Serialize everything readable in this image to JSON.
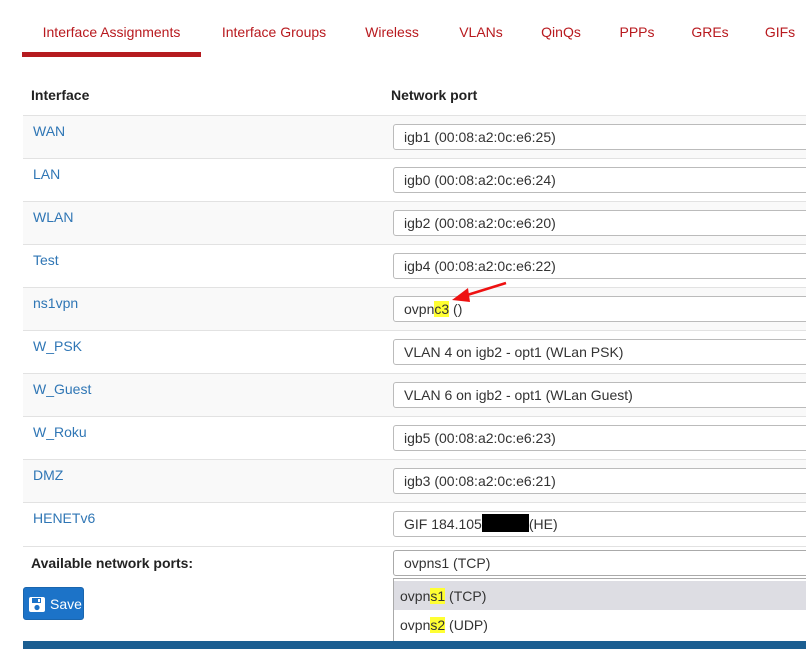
{
  "tabs": [
    {
      "label": "Interface Assignments",
      "active": true
    },
    {
      "label": "Interface Groups"
    },
    {
      "label": "Wireless"
    },
    {
      "label": "VLANs"
    },
    {
      "label": "QinQs"
    },
    {
      "label": "PPPs"
    },
    {
      "label": "GREs"
    },
    {
      "label": "GIFs"
    }
  ],
  "table": {
    "headers": [
      "Interface",
      "Network port"
    ],
    "rows": [
      {
        "interface": "WAN",
        "port": "igb1 (00:08:a2:0c:e6:25)"
      },
      {
        "interface": "LAN",
        "port": "igb0 (00:08:a2:0c:e6:24)"
      },
      {
        "interface": "WLAN",
        "port": "igb2 (00:08:a2:0c:e6:20)"
      },
      {
        "interface": "Test",
        "port": "igb4 (00:08:a2:0c:e6:22)"
      },
      {
        "interface": "ns1vpn",
        "port_parts": [
          "ovpn",
          "c3",
          " ()"
        ]
      },
      {
        "interface": "W_PSK",
        "port": "VLAN 4 on igb2 - opt1 (WLan PSK)"
      },
      {
        "interface": "W_Guest",
        "port": "VLAN 6 on igb2 - opt1 (WLan Guest)"
      },
      {
        "interface": "W_Roku",
        "port": "igb5 (00:08:a2:0c:e6:23)"
      },
      {
        "interface": "DMZ",
        "port": "igb3 (00:08:a2:0c:e6:21)"
      },
      {
        "interface": "HENETv6",
        "port_parts": [
          "GIF 184.105",
          "(HE)"
        ]
      }
    ]
  },
  "available": {
    "label": "Available network ports:",
    "selected": "ovpns1 (TCP)",
    "options": [
      {
        "parts": [
          "ovpn",
          "s1",
          " (TCP)"
        ]
      },
      {
        "parts": [
          "ovpn",
          "s2",
          " (UDP)"
        ]
      }
    ]
  },
  "save_label": "Save",
  "colors": {
    "accent": "#b8191e",
    "link": "#2f76b5",
    "button": "#1c73c8",
    "highlight": "#ffff33"
  },
  "icons": {
    "save": "floppy-disk-icon",
    "annotation": "red-arrow-icon"
  }
}
